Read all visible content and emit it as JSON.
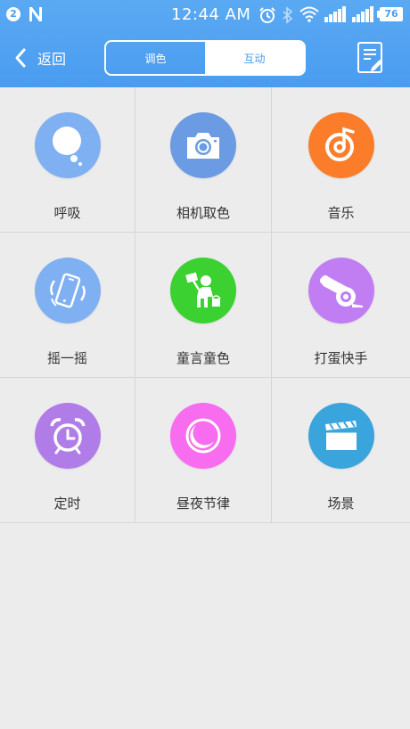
{
  "status_bar": {
    "notification_count": "2",
    "time": "12:44 AM",
    "battery": "76"
  },
  "nav": {
    "back_label": "返回",
    "tabs": [
      {
        "label": "调色",
        "active": true
      },
      {
        "label": "互动",
        "active": false
      }
    ],
    "accent": "#4a9cf0"
  },
  "features": [
    {
      "label": "呼吸",
      "icon": "bubble-icon",
      "color": "#7fb0f2"
    },
    {
      "label": "相机取色",
      "icon": "camera-icon",
      "color": "#6a9be3"
    },
    {
      "label": "音乐",
      "icon": "music-note-icon",
      "color": "#fb7d2a"
    },
    {
      "label": "摇一摇",
      "icon": "phone-shake-icon",
      "color": "#7fb0f2"
    },
    {
      "label": "童言童色",
      "icon": "painter-icon",
      "color": "#3bd130"
    },
    {
      "label": "打蛋快手",
      "icon": "cannon-icon",
      "color": "#c07ef2"
    },
    {
      "label": "定时",
      "icon": "alarm-clock-icon",
      "color": "#b07de8"
    },
    {
      "label": "昼夜节律",
      "icon": "moon-icon",
      "color": "#f86cf0"
    },
    {
      "label": "场景",
      "icon": "clapperboard-icon",
      "color": "#3aa4dc"
    }
  ]
}
